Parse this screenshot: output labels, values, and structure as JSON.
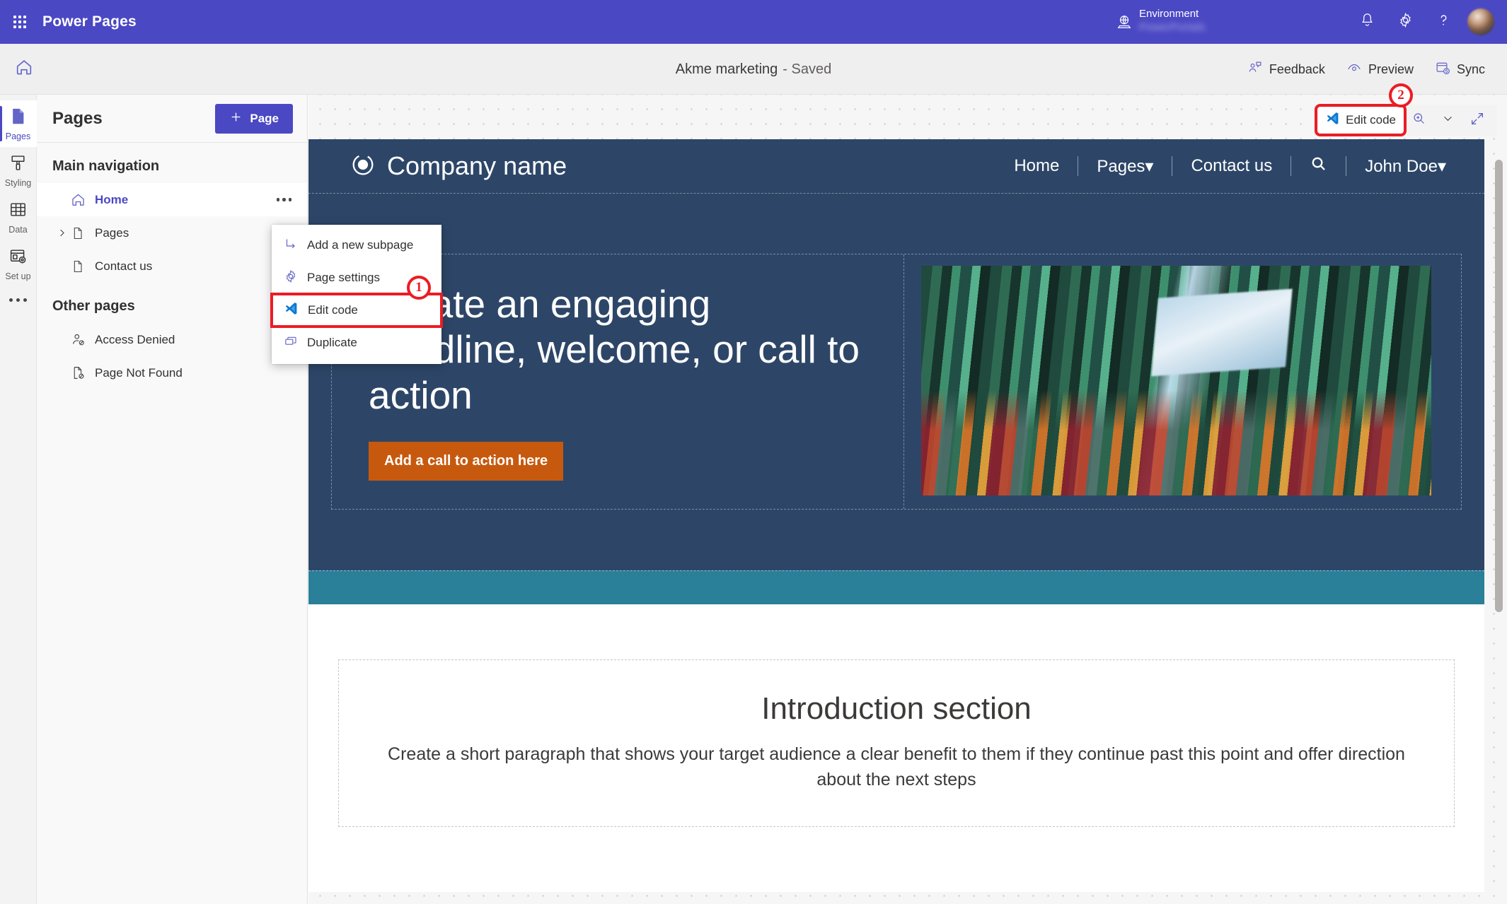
{
  "suite": {
    "waffle_icon": "app-launcher-icon",
    "brand": "Power Pages",
    "environment_label": "Environment",
    "environment_value": "PowerPortals",
    "globe_icon": "environment-globe-icon",
    "notifications_icon": "bell-icon",
    "settings_icon": "gear-icon",
    "help_icon": "question-mark-icon",
    "avatar": "user-avatar"
  },
  "command_bar": {
    "home_icon": "home-icon",
    "site_name": "Akme marketing",
    "save_state": "- Saved",
    "feedback_label": "Feedback",
    "preview_label": "Preview",
    "sync_label": "Sync"
  },
  "rail": {
    "items": [
      {
        "label": "Pages",
        "icon": "page-icon",
        "active": true
      },
      {
        "label": "Styling",
        "icon": "brush-icon",
        "active": false
      },
      {
        "label": "Data",
        "icon": "table-icon",
        "active": false
      },
      {
        "label": "Set up",
        "icon": "setup-icon",
        "active": false
      }
    ],
    "overflow": "more-icon"
  },
  "panel": {
    "title": "Pages",
    "add_page_label": "Page",
    "add_page_icon": "plus-icon",
    "main_navigation_label": "Main navigation",
    "other_pages_label": "Other pages",
    "main_nav": [
      {
        "label": "Home",
        "icon": "home-outline-icon",
        "selected": true,
        "expandable": false
      },
      {
        "label": "Pages",
        "icon": "file-icon",
        "selected": false,
        "expandable": true
      },
      {
        "label": "Contact us",
        "icon": "file-icon",
        "selected": false,
        "expandable": false
      }
    ],
    "other_pages": [
      {
        "label": "Access Denied",
        "icon": "person-blocked-icon"
      },
      {
        "label": "Page Not Found",
        "icon": "file-blocked-icon"
      }
    ]
  },
  "context_menu": {
    "items": [
      {
        "label": "Add a new subpage",
        "icon": "subpage-arrow-icon",
        "highlighted": false
      },
      {
        "label": "Page settings",
        "icon": "gear-icon",
        "highlighted": false
      },
      {
        "label": "Edit code",
        "icon": "vscode-icon",
        "highlighted": true
      },
      {
        "label": "Duplicate",
        "icon": "duplicate-icon",
        "highlighted": false
      }
    ]
  },
  "canvas_toolbar": {
    "edit_code_label": "Edit code",
    "edit_code_icon": "vscode-icon",
    "zoom_icon": "zoom-in-icon",
    "chevron_icon": "chevron-down-icon",
    "expand_icon": "expand-arrows-icon"
  },
  "annotations": {
    "badge_1": "1",
    "badge_2": "2",
    "highlight_color": "#ec1c24"
  },
  "site_preview": {
    "logo_icon": "circle-logo-icon",
    "company_name": "Company name",
    "nav": [
      {
        "label": "Home",
        "caret": false
      },
      {
        "label": "Pages",
        "caret": true
      },
      {
        "label": "Contact us",
        "caret": false
      },
      {
        "label": "search",
        "caret": false,
        "icon": "search-icon"
      },
      {
        "label": "John Doe",
        "caret": true
      }
    ],
    "hero": {
      "headline": "Create an engaging headline, welcome, or call to action",
      "cta_label": "Add a call to action here",
      "image_alt": "colorful-building-facade-image"
    },
    "intro": {
      "heading": "Introduction section",
      "paragraph": "Create a short paragraph that shows your target audience a clear benefit to them if they continue past this point and offer direction about the next steps"
    },
    "colors": {
      "header_bg": "#2d4668",
      "accent_band": "#2a7f99",
      "cta_bg": "#c7590e"
    }
  }
}
